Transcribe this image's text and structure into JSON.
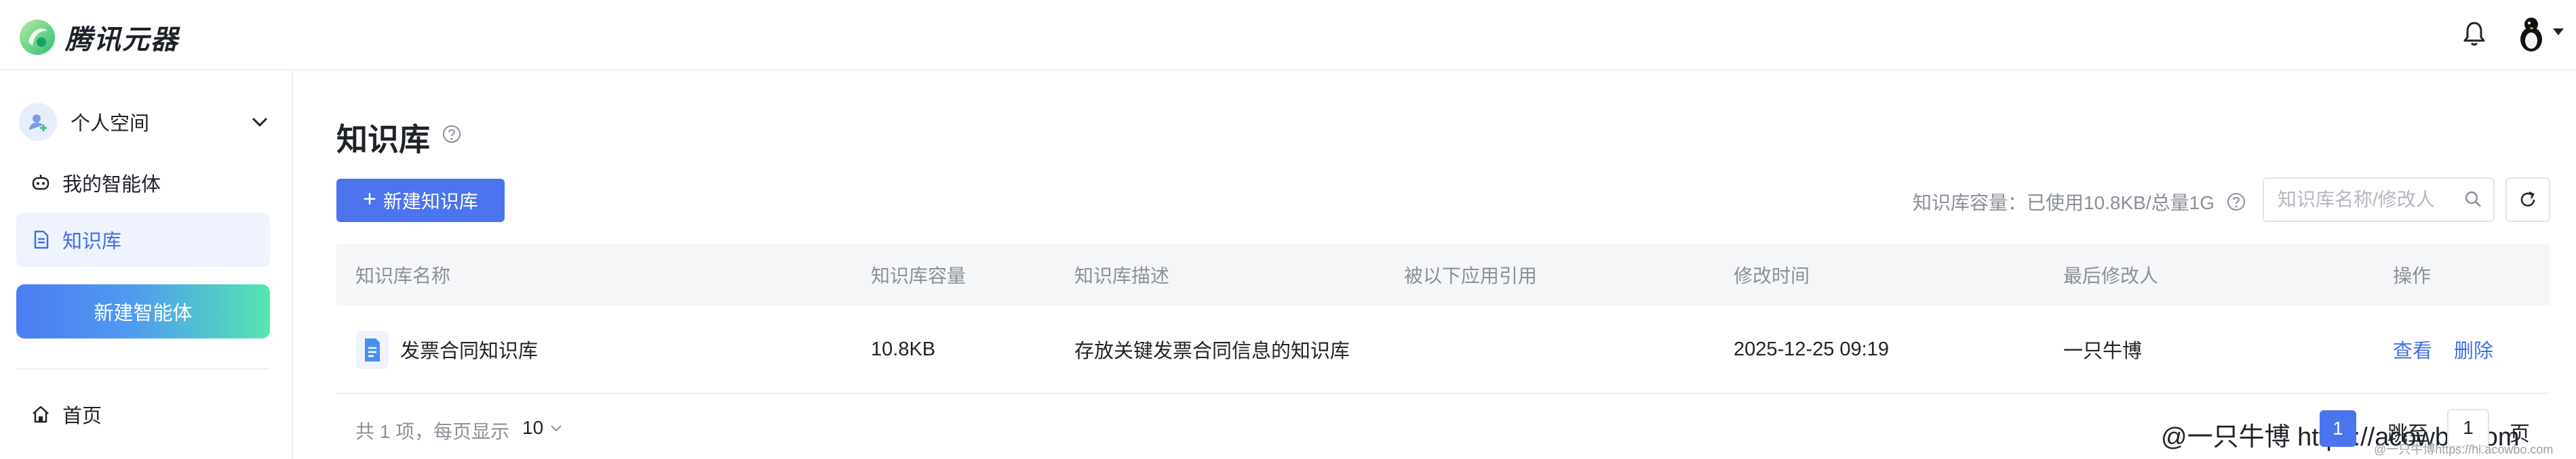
{
  "app": {
    "name": "腾讯元器"
  },
  "sidebar": {
    "space_label": "个人空间",
    "items": [
      {
        "label": "我的智能体",
        "icon": "robot-icon"
      },
      {
        "label": "知识库",
        "icon": "document-icon",
        "active": true
      }
    ],
    "new_agent_label": "新建智能体",
    "home_label": "首页"
  },
  "main": {
    "title": "知识库",
    "create_label": "新建知识库",
    "capacity_text": "知识库容量：已使用10.8KB/总量1G",
    "search_placeholder": "知识库名称/修改人",
    "columns": [
      "知识库名称",
      "知识库容量",
      "知识库描述",
      "被以下应用引用",
      "修改时间",
      "最后修改人",
      "操作"
    ],
    "rows": [
      {
        "name": "发票合同知识库",
        "size": "10.8KB",
        "description": "存放关键发票合同信息的知识库",
        "referenced_by": "",
        "modified": "2025-12-25 09:19",
        "modifier": "一只牛博",
        "action_view": "查看",
        "action_delete": "删除"
      }
    ],
    "footer": {
      "total": "共 1 项，每页显示",
      "page_size": "10",
      "current_page": "1",
      "jump_label": "跳至",
      "jump_value": "1",
      "page_suffix": "页"
    }
  },
  "watermark": "@一只牛博 https://acowbo.com",
  "watermark_small": "@一只牛博https://hi.acowbo.com",
  "colors": {
    "accent": "#4c74ee",
    "active_bg": "#eef3fd",
    "gradient_end": "#56e6b1"
  }
}
